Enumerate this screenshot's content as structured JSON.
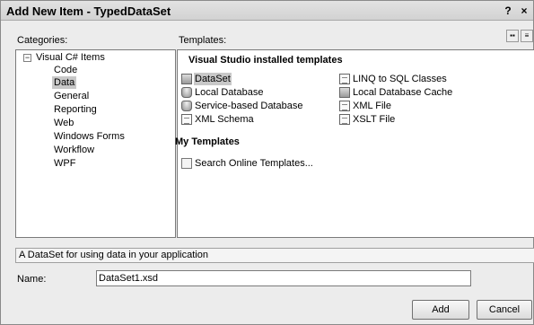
{
  "window": {
    "title": "Add New Item - TypedDataSet",
    "help_label": "?",
    "close_label": "×"
  },
  "labels": {
    "categories": "Categories:",
    "templates": "Templates:",
    "name": "Name:"
  },
  "view_buttons": {
    "large_icons": "▪▪",
    "small_icons": "≡"
  },
  "categories": {
    "root_label": "Visual C# Items",
    "root_expander": "−",
    "items": [
      {
        "label": "Code"
      },
      {
        "label": "Data",
        "selected": true
      },
      {
        "label": "General"
      },
      {
        "label": "Reporting"
      },
      {
        "label": "Web"
      },
      {
        "label": "Windows Forms"
      },
      {
        "label": "Workflow"
      },
      {
        "label": "WPF"
      }
    ]
  },
  "templates": {
    "installed_header": "Visual Studio installed templates",
    "installed": [
      {
        "label": "DataSet",
        "icon": "dataset-icon",
        "selected": true
      },
      {
        "label": "Local Database",
        "icon": "database-icon"
      },
      {
        "label": "Service-based Database",
        "icon": "database-icon"
      },
      {
        "label": "XML Schema",
        "icon": "schema-icon"
      },
      {
        "label": "LINQ to SQL Classes",
        "icon": "linq-icon"
      },
      {
        "label": "Local Database Cache",
        "icon": "cache-icon"
      },
      {
        "label": "XML File",
        "icon": "xml-file-icon"
      },
      {
        "label": "XSLT File",
        "icon": "xslt-file-icon"
      }
    ],
    "my_header": "My Templates",
    "my": [
      {
        "label": "Search Online Templates...",
        "icon": "search-online-icon"
      }
    ]
  },
  "description": "A DataSet for using data in your application",
  "name_field": {
    "value": "DataSet1.xsd"
  },
  "buttons": {
    "add": "Add",
    "cancel": "Cancel"
  }
}
